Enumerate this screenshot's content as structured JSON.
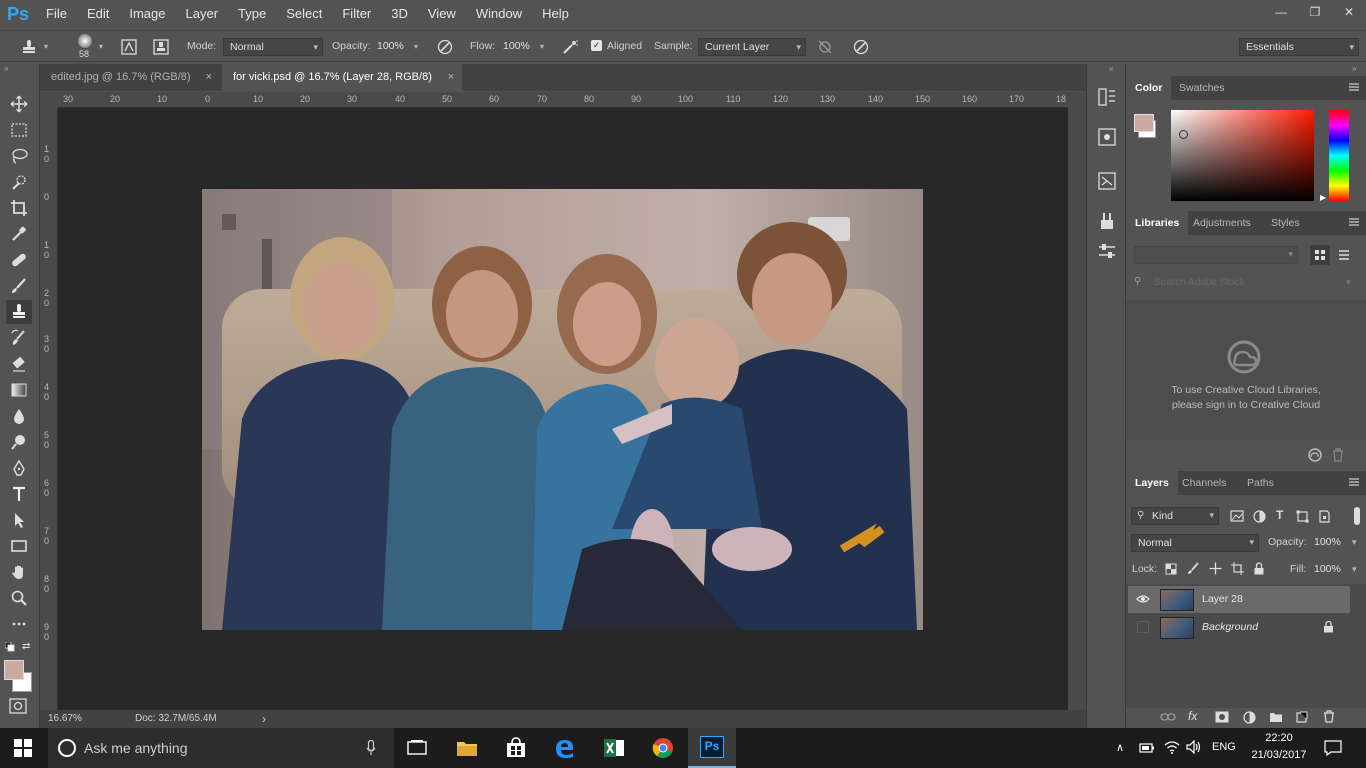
{
  "app": {
    "logo": "Ps",
    "menu": [
      "File",
      "Edit",
      "Image",
      "Layer",
      "Type",
      "Select",
      "Filter",
      "3D",
      "View",
      "Window",
      "Help"
    ],
    "window_controls": {
      "minimize": "—",
      "restore": "❐",
      "close": "✕"
    }
  },
  "options": {
    "brush_size": "58",
    "mode_label": "Mode:",
    "mode_value": "Normal",
    "opacity_label": "Opacity:",
    "opacity_value": "100%",
    "flow_label": "Flow:",
    "flow_value": "100%",
    "aligned_label": "Aligned",
    "aligned_checked": true,
    "sample_label": "Sample:",
    "sample_value": "Current Layer",
    "workspace": "Essentials"
  },
  "tabs": [
    {
      "label": "edited.jpg @ 16.7% (RGB/8)",
      "close": "×",
      "active": false
    },
    {
      "label": "for vicki.psd @ 16.7% (Layer 28, RGB/8)",
      "close": "×",
      "active": true
    }
  ],
  "ruler": {
    "top": [
      "30",
      "20",
      "10",
      "0",
      "10",
      "20",
      "30",
      "40",
      "50",
      "60",
      "70",
      "80",
      "90",
      "100",
      "110",
      "120",
      "130",
      "140",
      "150",
      "160",
      "170",
      "18"
    ],
    "left": [
      "10",
      "0",
      "10",
      "20",
      "30",
      "40",
      "50",
      "60",
      "70",
      "80",
      "90"
    ]
  },
  "status": {
    "zoom": "16.67%",
    "doc": "Doc: 32.7M/65.4M",
    "arrow": "›"
  },
  "color_panel": {
    "tabs": [
      "Color",
      "Swatches"
    ],
    "foreground": "#c9a9a0",
    "background": "#ffffff"
  },
  "libraries_panel": {
    "tabs": [
      "Libraries",
      "Adjustments",
      "Styles"
    ],
    "search_placeholder": "Search Adobe Stock",
    "message": [
      "To use Creative Cloud Libraries,",
      "please sign in to Creative Cloud"
    ]
  },
  "layers_panel": {
    "tabs": [
      "Layers",
      "Channels",
      "Paths"
    ],
    "filter_kind": "Kind",
    "blend_mode": "Normal",
    "opacity_label": "Opacity:",
    "opacity_value": "100%",
    "lock_label": "Lock:",
    "fill_label": "Fill:",
    "fill_value": "100%",
    "layers": [
      {
        "name": "Layer 28",
        "visible": true,
        "selected": true,
        "locked": false
      },
      {
        "name": "Background",
        "visible": false,
        "selected": false,
        "locked": true
      }
    ]
  },
  "taskbar": {
    "search_placeholder": "Ask me anything",
    "lang": "ENG",
    "time": "22:20",
    "date": "21/03/2017"
  },
  "colors": {
    "ui_bg": "#535353",
    "canvas_bg": "#282828",
    "accent_ps": "#31a8ff",
    "taskbar": "#1c1c1c"
  }
}
